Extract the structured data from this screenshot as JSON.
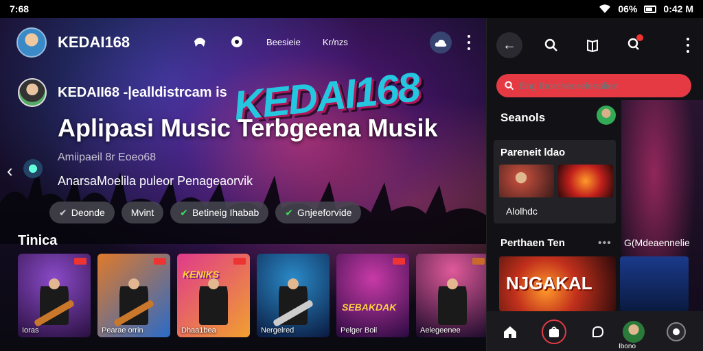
{
  "status": {
    "time": "7:68",
    "battery": "06%",
    "clock": "0:42 M"
  },
  "header": {
    "brand": "KEDAI168",
    "links": [
      "Beesieie",
      "Kr/nzs"
    ]
  },
  "hero": {
    "logo": "KEDAI168",
    "channel": "KEDAII68 -|ealldistrcam is",
    "headline": "Aplipasi Music Terbgeena Musik",
    "sub1": "Amiipaeil 8r Eoeo68",
    "sub2": "AnarsaMoelila puleor Penageaorvik",
    "chips": [
      {
        "label": "Deonde",
        "checked": true
      },
      {
        "label": "Mvint",
        "checked": false
      },
      {
        "label": "Betineig Ihabab",
        "checked": true
      },
      {
        "label": "Gnjeeforvide",
        "checked": true
      }
    ]
  },
  "row": {
    "title": "Tinica",
    "cards": [
      {
        "caption": "Ioras",
        "title": ""
      },
      {
        "caption": "Pearae orrin",
        "title": ""
      },
      {
        "caption": "Dhaa1bea",
        "title": "KENIKS"
      },
      {
        "caption": "Nergelred",
        "title": ""
      },
      {
        "caption": "Pelger Boil",
        "title": "SEBAKDAK"
      },
      {
        "caption": "Aelegeenee",
        "title": ""
      }
    ]
  },
  "panel": {
    "search_placeholder": "Eng Iborcheorelenalien",
    "section1": "Seanols",
    "video_title": "Pareneit ldao",
    "video_footer": "Alolhdc",
    "section2": "Perthaen Ten",
    "section3": "G(Mdeaennelie",
    "promo": "NJGAKAL",
    "nav_avatar_label": "Ibono"
  },
  "colors": {
    "accent": "#e53a44",
    "check": "#3ddc5a",
    "logo_cyan": "#25c7e0"
  }
}
